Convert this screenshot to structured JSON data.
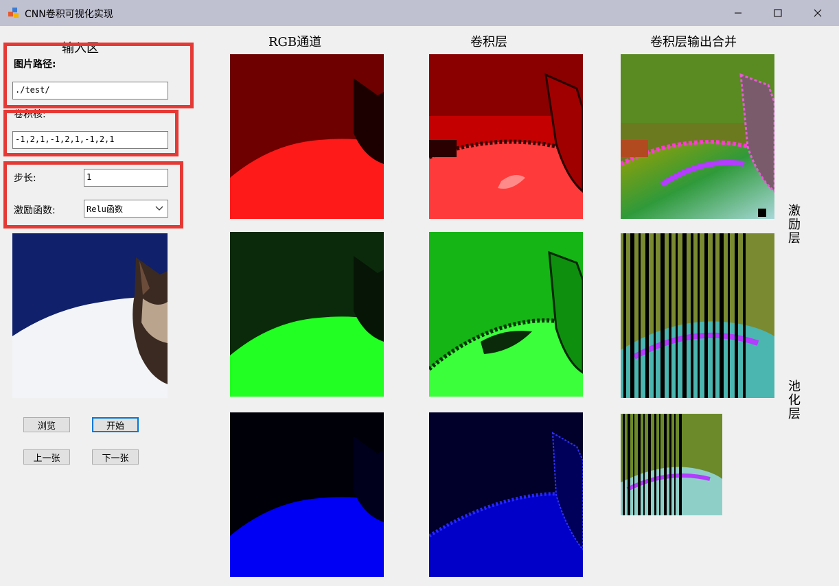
{
  "window": {
    "title": "CNN卷积可视化实现"
  },
  "input_area": {
    "title": "输入区",
    "image_path_label": "图片路径:",
    "image_path_value": "./test/",
    "kernel_label": "卷积核:",
    "kernel_value": "-1,2,1,-1,2,1,-1,2,1",
    "stride_label": "步长:",
    "stride_value": "1",
    "activation_label": "激励函数:",
    "activation_value": "Relu函数"
  },
  "buttons": {
    "browse": "浏览",
    "start": "开始",
    "prev": "上一张",
    "next": "下一张"
  },
  "columns": {
    "rgb": "RGB通道",
    "conv": "卷积层",
    "merged": "卷积层输出合并"
  },
  "side_labels": {
    "activation_layer": "激励层",
    "pooling_layer": "池化层"
  },
  "colors": {
    "accent": "#0078d7",
    "highlight_border": "#e53935",
    "titlebar": "#bfc0d0"
  }
}
